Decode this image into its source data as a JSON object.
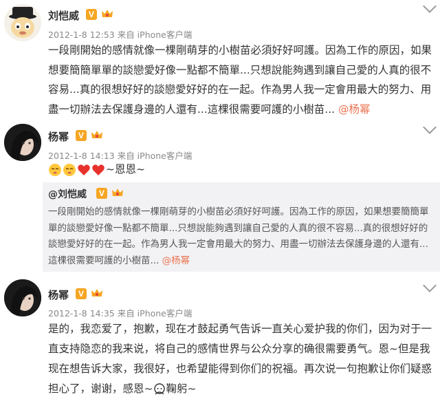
{
  "colors": {
    "orange": "#eb7350",
    "badge": "#f6a623",
    "meta": "#888888",
    "repost_bg": "#f2f2f5"
  },
  "posts": [
    {
      "author": "刘恺威",
      "meta": "2012-1-8 12:53 来自 iPhone客户端",
      "text": "一段剛開始的感情就像一棵剛萌芽的小樹苗必須好好呵護。因為工作的原因，如果想要簡簡單單的談戀愛好像一點都不簡單...只想說能夠遇到讓自己愛的人真的很不容易...真的很想好好的談戀愛好好的在一起。作為男人我一定會用最大的努力、用盡一切辦法去保護身邊的人還有...這棵很需要呵護的小樹苗...",
      "mention": "@杨幂"
    },
    {
      "author": "杨幂",
      "meta": "2012-1-8 14:13 来自 iPhone客户端",
      "text": "~恩恩~",
      "repost": {
        "author": "@刘恺威",
        "text": "一段剛開始的感情就像一棵剛萌芽的小樹苗必須好好呵護。因為工作的原因，如果想要簡簡單單的談戀愛好像一點都不簡單...只想說能夠遇到讓自己愛的人真的很不容易...真的很想好好的談戀愛好好的在一起。作為男人我一定會用最大的努力、用盡一切辦法去保護身邊的人還有...這棵很需要呵護的小樹苗...",
        "mention": "@杨幂"
      }
    },
    {
      "author": "杨幂",
      "meta": "2012-1-8 14:35 来自 iPhone客户端",
      "text": "是的，我恋爱了，抱歉，现在才鼓起勇气告诉一直关心爱护我的你们，因为对于一直支持隐恋的我来说，将自己的感情世界与公众分享的确很需要勇气。恩~但是我现在想告诉大家，我很好，也希望能得到你们的祝福。再次说一句抱歉让你们疑惑担心了，谢谢，感恩~",
      "tail": "鞠躬~"
    }
  ],
  "icons": [
    "verified-v-icon",
    "crown-member-icon",
    "chevron-down-icon",
    "heart-icon",
    "sleepy-face-icon",
    "bowing-icon"
  ]
}
